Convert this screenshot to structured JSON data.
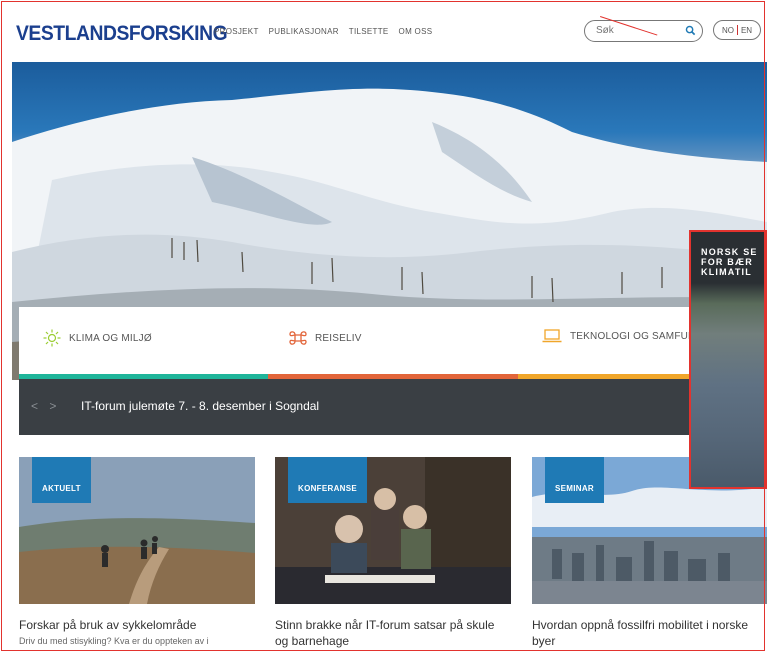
{
  "header": {
    "logo": "VESTLANDSFORSKING",
    "nav": [
      "PROSJEKT",
      "PUBLIKASJONAR",
      "TILSETTE",
      "OM OSS"
    ],
    "search_placeholder": "Søk",
    "lang": {
      "no": "NO",
      "en": "EN"
    }
  },
  "categories": [
    {
      "label": "KLIMA OG MILJØ",
      "icon": "sun-icon",
      "color": "#1fb59a"
    },
    {
      "label": "REISELIV",
      "icon": "command-icon",
      "color": "#e2653a"
    },
    {
      "label": "TEKNOLOGI OG SAMFUN",
      "icon": "laptop-icon",
      "color": "#f0a62a"
    }
  ],
  "ticker": {
    "arrows": "< >",
    "text": "IT-forum julemøte 7. - 8. desember i Sogndal"
  },
  "cards": [
    {
      "tag": "AKTUELT",
      "title": "Forskar på bruk av sykkelområde",
      "excerpt": "Driv du med stisykling? Kva er du oppteken av i"
    },
    {
      "tag": "KONFERANSE",
      "title": "Stinn brakke når IT-forum satsar på skule og barnehage",
      "excerpt": ""
    },
    {
      "tag": "SEMINAR",
      "title": "Hvordan oppnå fossilfri mobilitet i norske byer",
      "excerpt": ""
    }
  ],
  "popup": {
    "lines": [
      "NORSK SE",
      "FOR BÆR",
      "KLIMATIL"
    ]
  },
  "colors": {
    "brand": "#1b3f8e",
    "tag": "#1f7ab5",
    "ticker": "#3a3f44"
  }
}
